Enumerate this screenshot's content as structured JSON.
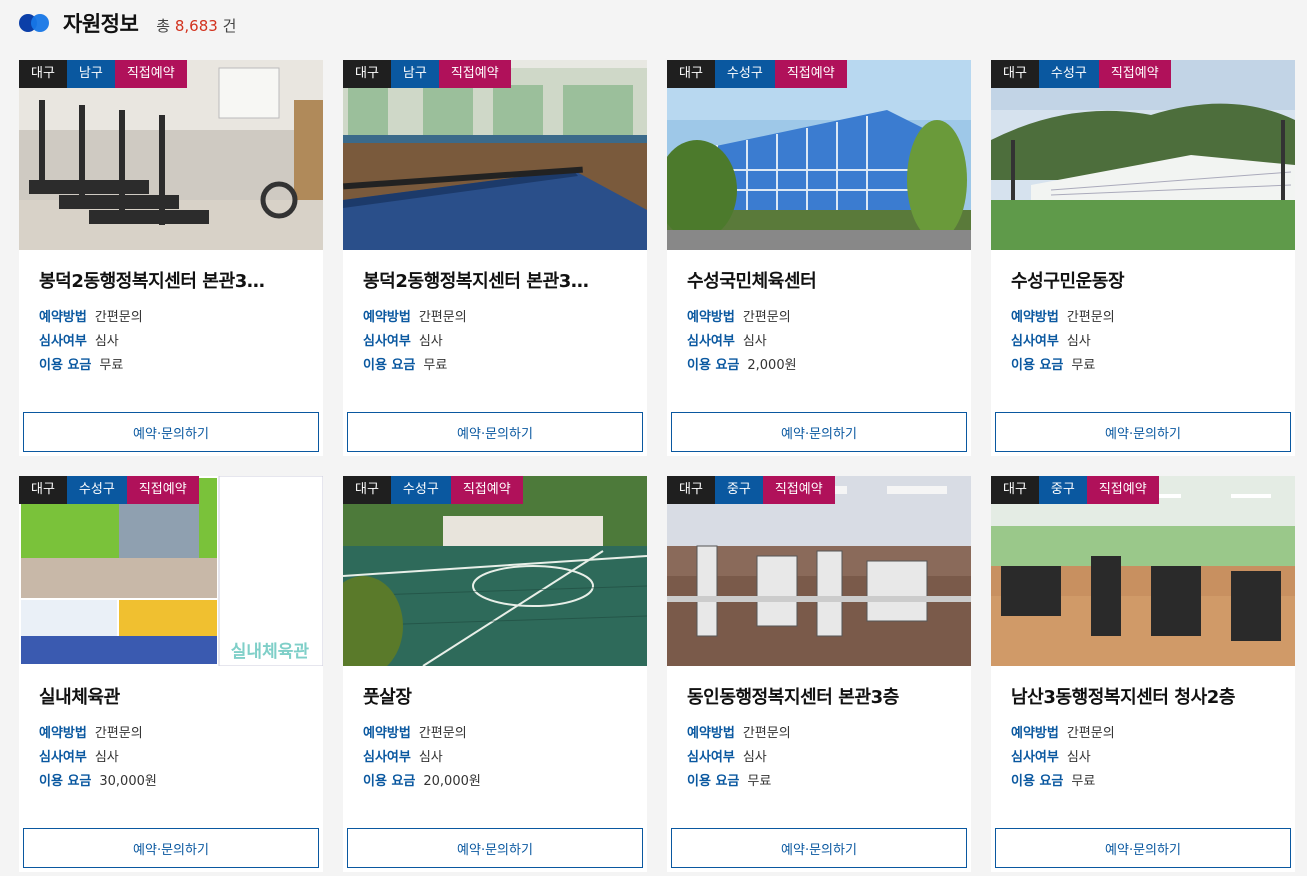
{
  "header": {
    "title": "자원정보",
    "total_prefix": "총",
    "total_count": "8,683",
    "total_suffix": "건"
  },
  "labels": {
    "method": "예약방법",
    "review": "심사여부",
    "fee": "이용 요금",
    "button": "예약·문의하기"
  },
  "colors": {
    "accent_blue": "#0a58a0",
    "reserve_magenta": "#b0115a",
    "count_red": "#d2321e"
  },
  "cards": [
    {
      "city": "대구",
      "district": "남구",
      "reserve": "직접예약",
      "name": "봉덕2동행정복지센터 본관3…",
      "method": "간편문의",
      "review": "심사",
      "fee": "무료",
      "image": "gym-treadmills"
    },
    {
      "city": "대구",
      "district": "남구",
      "reserve": "직접예약",
      "name": "봉덕2동행정복지센터 본관3…",
      "method": "간편문의",
      "review": "심사",
      "fee": "무료",
      "image": "table-tennis-room"
    },
    {
      "city": "대구",
      "district": "수성구",
      "reserve": "직접예약",
      "name": "수성국민체육센터",
      "method": "간편문의",
      "review": "심사",
      "fee": "2,000원",
      "image": "sports-center-building"
    },
    {
      "city": "대구",
      "district": "수성구",
      "reserve": "직접예약",
      "name": "수성구민운동장",
      "method": "간편문의",
      "review": "심사",
      "fee": "무료",
      "image": "stadium"
    },
    {
      "city": "대구",
      "district": "수성구",
      "reserve": "직접예약",
      "name": "실내체육관",
      "method": "간편문의",
      "review": "심사",
      "fee": "30,000원",
      "image": "indoor-gym-collage",
      "image_text": "실내체육관"
    },
    {
      "city": "대구",
      "district": "수성구",
      "reserve": "직접예약",
      "name": "풋살장",
      "method": "간편문의",
      "review": "심사",
      "fee": "20,000원",
      "image": "futsal-court"
    },
    {
      "city": "대구",
      "district": "중구",
      "reserve": "직접예약",
      "name": "동인동행정복지센터 본관3층",
      "method": "간편문의",
      "review": "심사",
      "fee": "무료",
      "image": "gym-machines"
    },
    {
      "city": "대구",
      "district": "중구",
      "reserve": "직접예약",
      "name": "남산3동행정복지센터 청사2층",
      "method": "간편문의",
      "review": "심사",
      "fee": "무료",
      "image": "fitness-room"
    }
  ]
}
